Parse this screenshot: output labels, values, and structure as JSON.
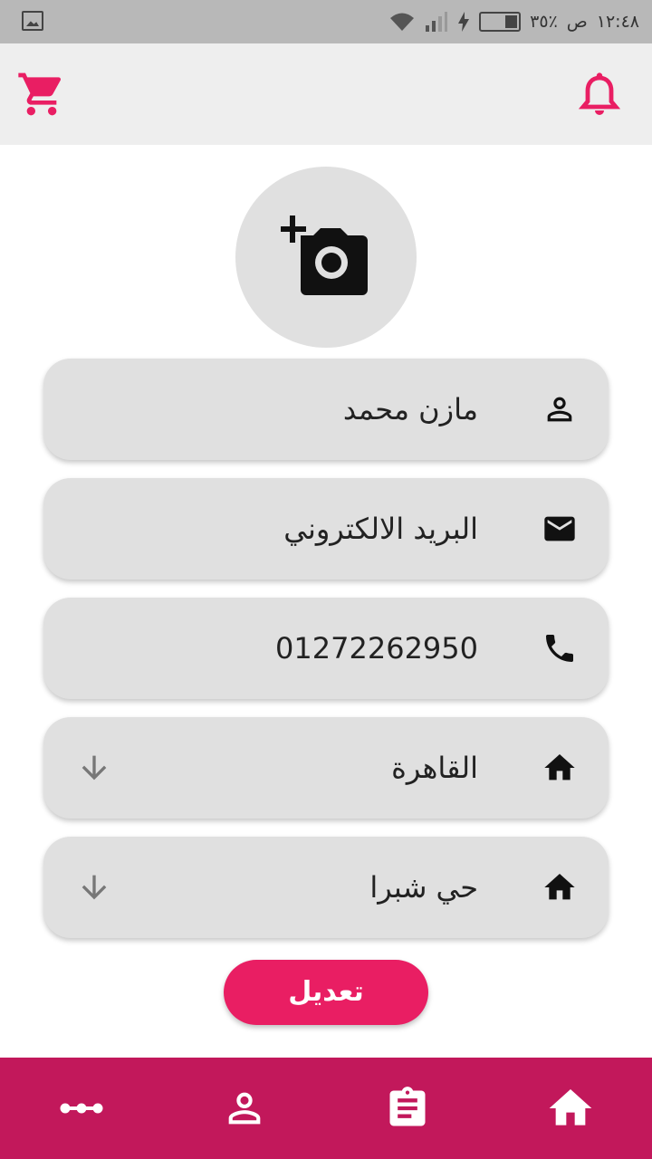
{
  "status_bar": {
    "time": "١٢:٤٨",
    "am_pm": "ص",
    "battery": "٣٥٪"
  },
  "header": {
    "cart_icon": "shopping-cart-icon",
    "bell_icon": "notification-bell-icon",
    "accent_color": "#e91e63"
  },
  "profile": {
    "photo_icon": "add-a-photo-icon",
    "fields": [
      {
        "icon": "person-icon",
        "value": "مازن محمد"
      },
      {
        "icon": "email-icon",
        "value": "البريد الالكتروني"
      },
      {
        "icon": "phone-icon",
        "value": "01272262950"
      },
      {
        "icon": "home-icon",
        "value": "القاهرة"
      },
      {
        "icon": "home-icon",
        "value": "حي شبرا"
      }
    ],
    "edit_label": "تعديل"
  },
  "bottom_nav": {
    "background": "#c2185b",
    "items": [
      "more-icon",
      "person-icon",
      "assignment-icon",
      "home-icon"
    ]
  }
}
